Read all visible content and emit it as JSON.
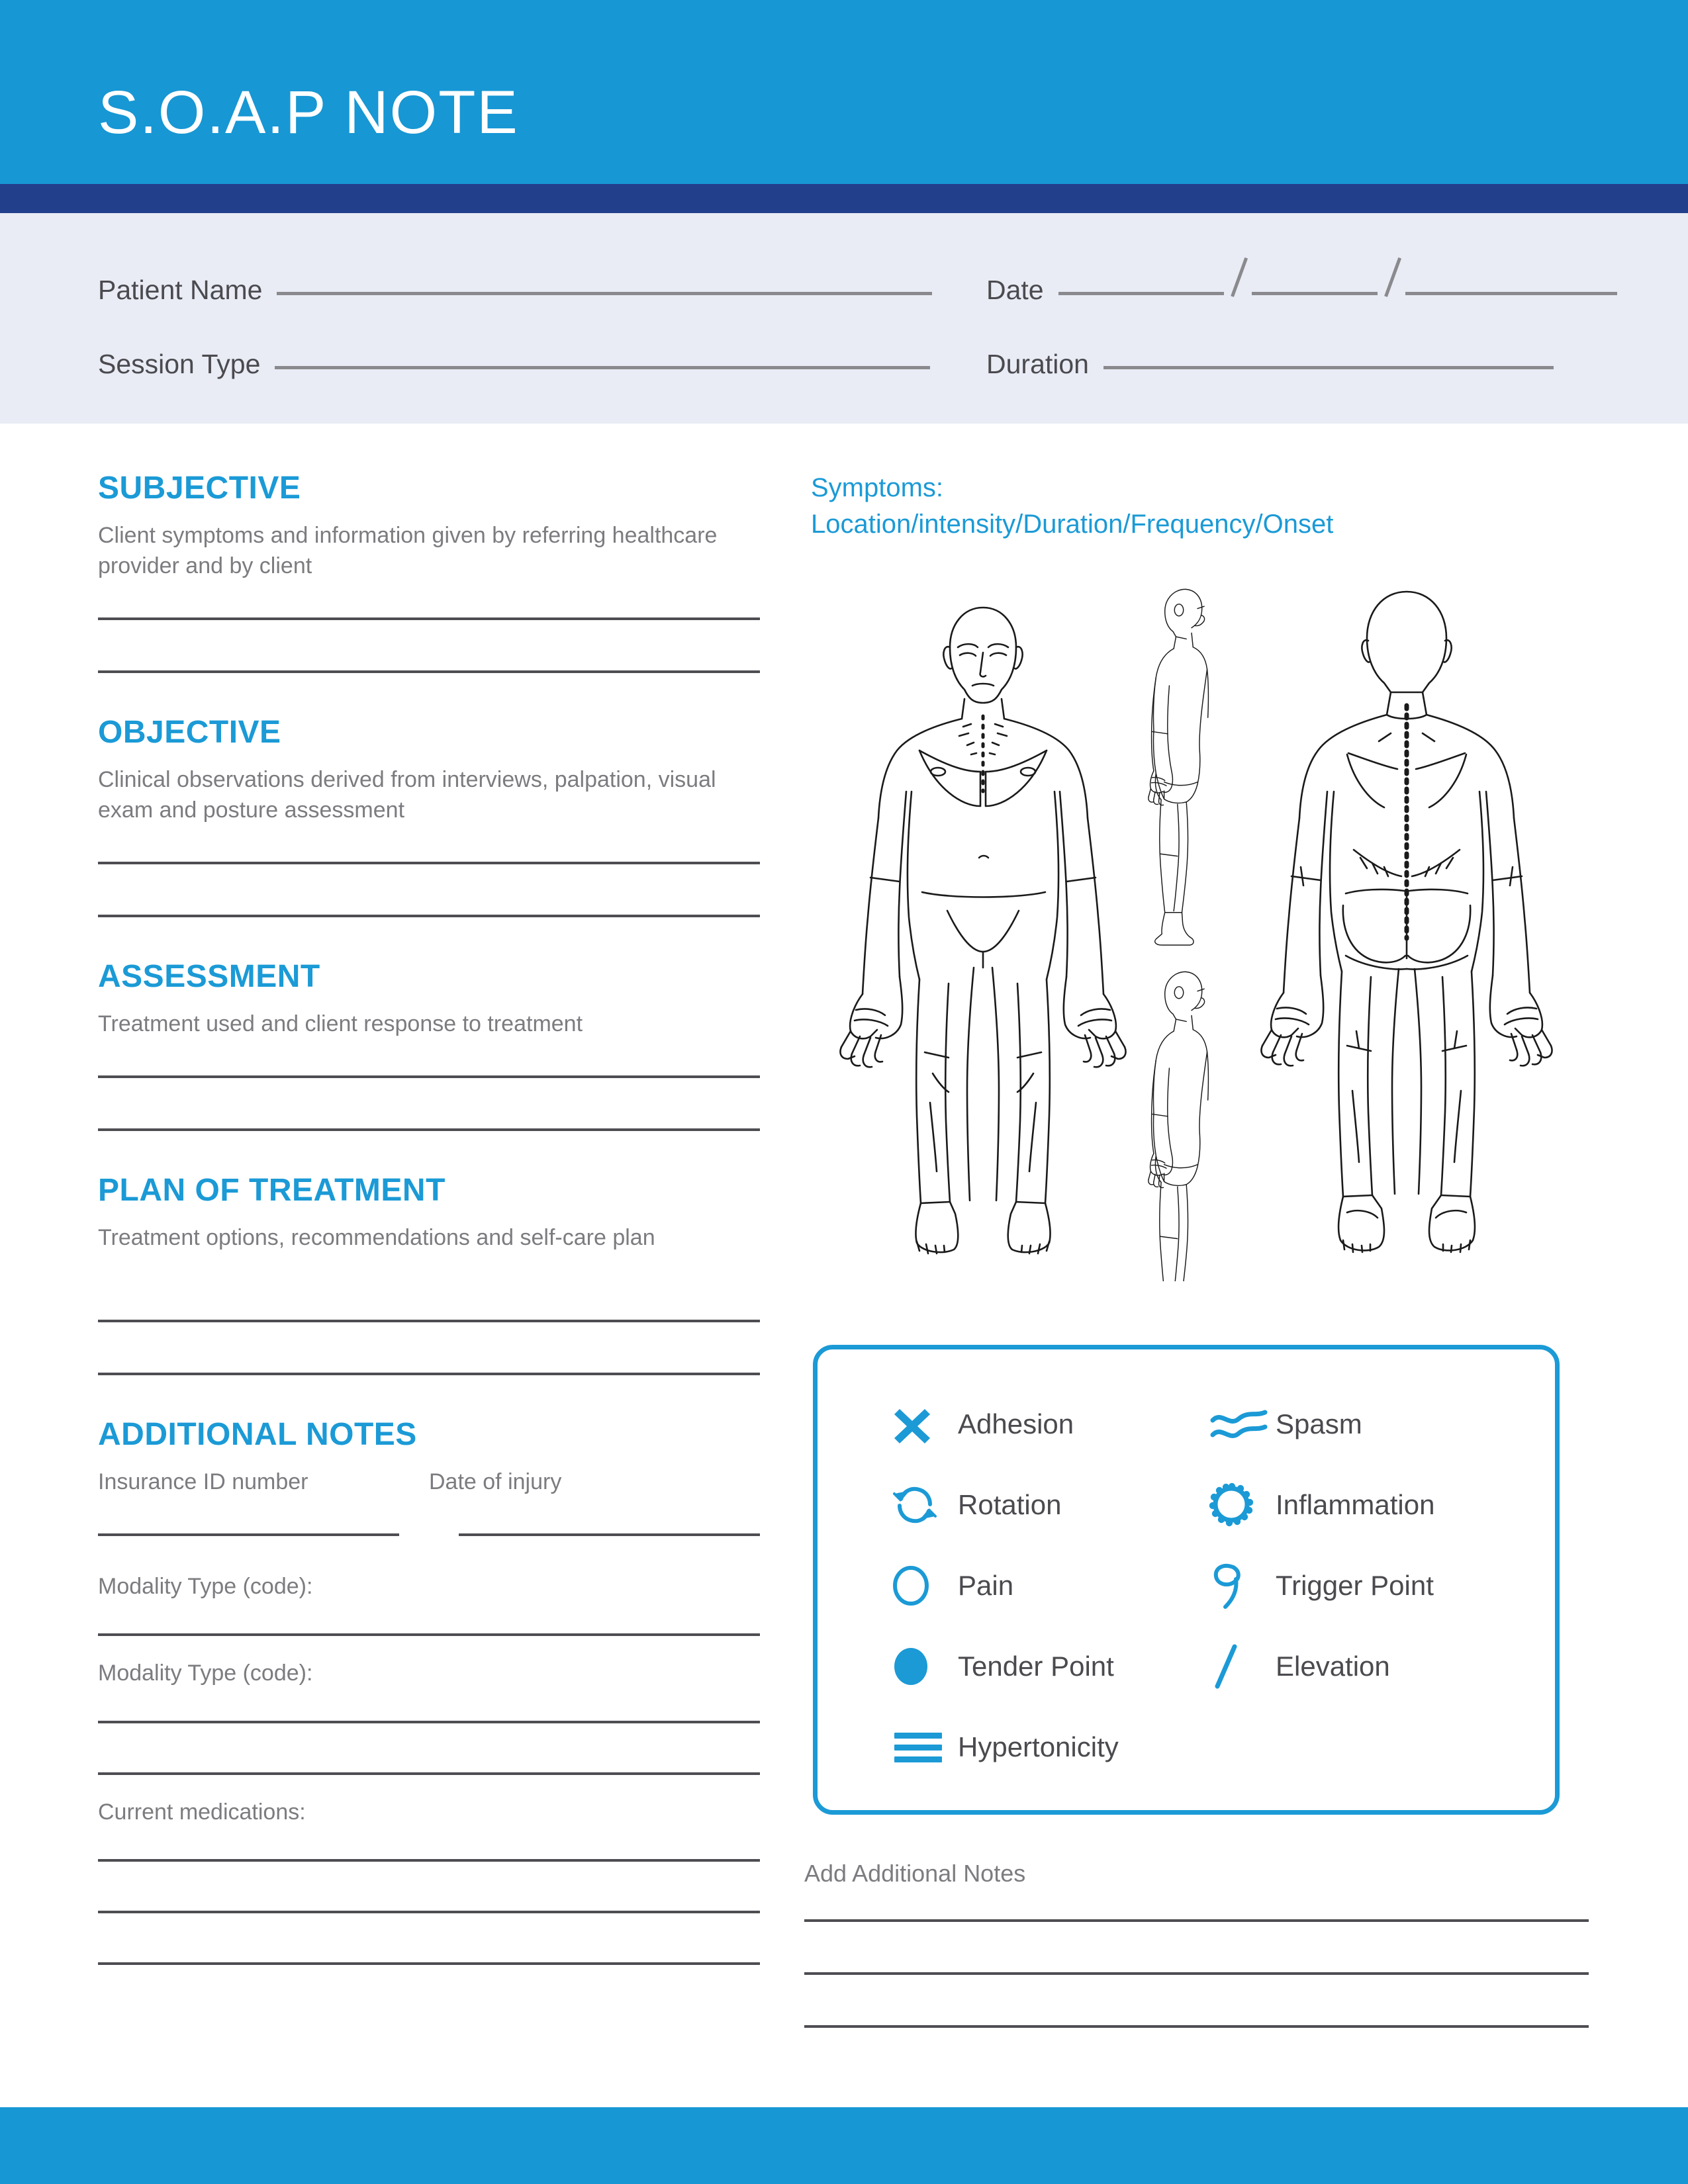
{
  "header": {
    "title": "S.O.A.P NOTE"
  },
  "patient_info": {
    "patient_name_label": "Patient Name",
    "date_label": "Date",
    "session_type_label": "Session Type",
    "duration_label": "Duration"
  },
  "left_sections": [
    {
      "title": "SUBJECTIVE",
      "description": "Client symptoms and information given by referring healthcare provider and by client",
      "lines": 2
    },
    {
      "title": "OBJECTIVE",
      "description": "Clinical observations derived from interviews, palpation, visual exam and posture assessment",
      "lines": 2
    },
    {
      "title": "ASSESSMENT",
      "description": "Treatment used and client response to treatment",
      "lines": 2
    },
    {
      "title": "PLAN OF TREATMENT",
      "description": "Treatment options, recommendations and self-care plan",
      "lines": 2
    }
  ],
  "additional_notes": {
    "title": "ADDITIONAL NOTES",
    "insurance_id_label": "Insurance ID number",
    "date_of_injury_label": "Date of injury",
    "modality_1_label": "Modality Type (code):",
    "modality_2_label": "Modality Type (code):",
    "current_medications_label": "Current medications:"
  },
  "symptoms": {
    "heading": "Symptoms:",
    "subheading": "Location/intensity/Duration/Frequency/Onset"
  },
  "body_diagram": {
    "views": [
      "anterior-full",
      "lateral-upper",
      "lateral-lower",
      "posterior-full"
    ]
  },
  "legend": {
    "items": [
      {
        "icon": "x-cross-icon",
        "label": "Adhesion"
      },
      {
        "icon": "wave-lines-icon",
        "label": "Spasm"
      },
      {
        "icon": "circular-arrows-icon",
        "label": "Rotation"
      },
      {
        "icon": "starburst-circle-icon",
        "label": "Inflammation"
      },
      {
        "icon": "open-circle-icon",
        "label": "Pain"
      },
      {
        "icon": "hook-loop-icon",
        "label": "Trigger Point"
      },
      {
        "icon": "filled-circle-icon",
        "label": "Tender Point"
      },
      {
        "icon": "diagonal-slash-icon",
        "label": "Elevation"
      },
      {
        "icon": "triple-bar-icon",
        "label": "Hypertonicity"
      }
    ]
  },
  "bottom_notes": {
    "label": "Add Additional Notes",
    "lines": 3
  },
  "colors": {
    "header_blue": "#1797D4",
    "navy_strip": "#223F8C",
    "info_band": "#E9ECF5",
    "accent_blue": "#1B9AD6",
    "body_text_gray": "#7C7C80",
    "line_dark": "#4D4D52",
    "line_light": "#8A8A8E"
  }
}
